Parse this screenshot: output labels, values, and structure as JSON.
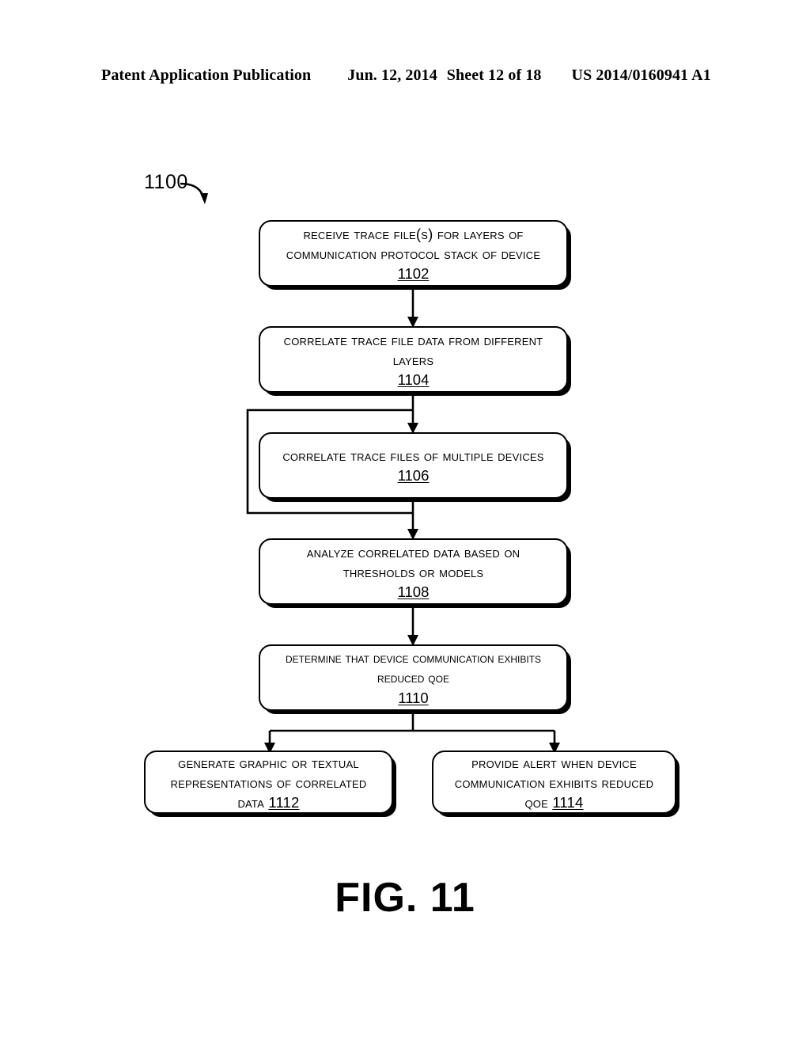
{
  "header": {
    "publication": "Patent Application Publication",
    "date": "Jun. 12, 2014",
    "sheet": "Sheet 12 of 18",
    "patent_number": "US 2014/0160941 A1"
  },
  "figure": {
    "label": "FIG. 11",
    "reference_numeral": "1100"
  },
  "flowchart": {
    "boxes": [
      {
        "id": "1102",
        "text": "Receive Trace File(s) for Layers of\nCommunication Protocol Stack of Device",
        "number": "1102",
        "number_inline": false
      },
      {
        "id": "1104",
        "text": "Correlate Trace File Data from Different\nLayers",
        "number": "1104",
        "number_inline": false
      },
      {
        "id": "1106",
        "text": "Correlate Trace Files of Multiple Devices",
        "number": "1106",
        "number_inline": false
      },
      {
        "id": "1108",
        "text": "Analyze Correlated Data Based on\nThresholds or Models",
        "number": "1108",
        "number_inline": false
      },
      {
        "id": "1110",
        "text": "Determine that Device Communication Exhibits\nReduced QoE",
        "number": "1110",
        "number_inline": false
      },
      {
        "id": "1112",
        "text": "Generate Graphic or Textual\nRepresentations of Correlated\nData ",
        "number": "1112",
        "number_inline": true
      },
      {
        "id": "1114",
        "text": "Provide Alert When Device\nCommunication Exhibits Reduced\nQoE ",
        "number": "1114",
        "number_inline": true
      }
    ],
    "connectors": [
      {
        "name": "arrow-1102-to-1104",
        "type": "vertical-arrow"
      },
      {
        "name": "arrow-1104-to-1106",
        "type": "vertical-arrow"
      },
      {
        "name": "bypass-around-1106",
        "type": "bypass-loop"
      },
      {
        "name": "arrow-1106-to-1108",
        "type": "vertical-arrow"
      },
      {
        "name": "arrow-1108-to-1110",
        "type": "vertical-arrow"
      },
      {
        "name": "fork-1110-to-1112-and-1114",
        "type": "fork-arrow"
      }
    ]
  },
  "colors": {
    "ink": "#000000",
    "page": "#ffffff"
  }
}
